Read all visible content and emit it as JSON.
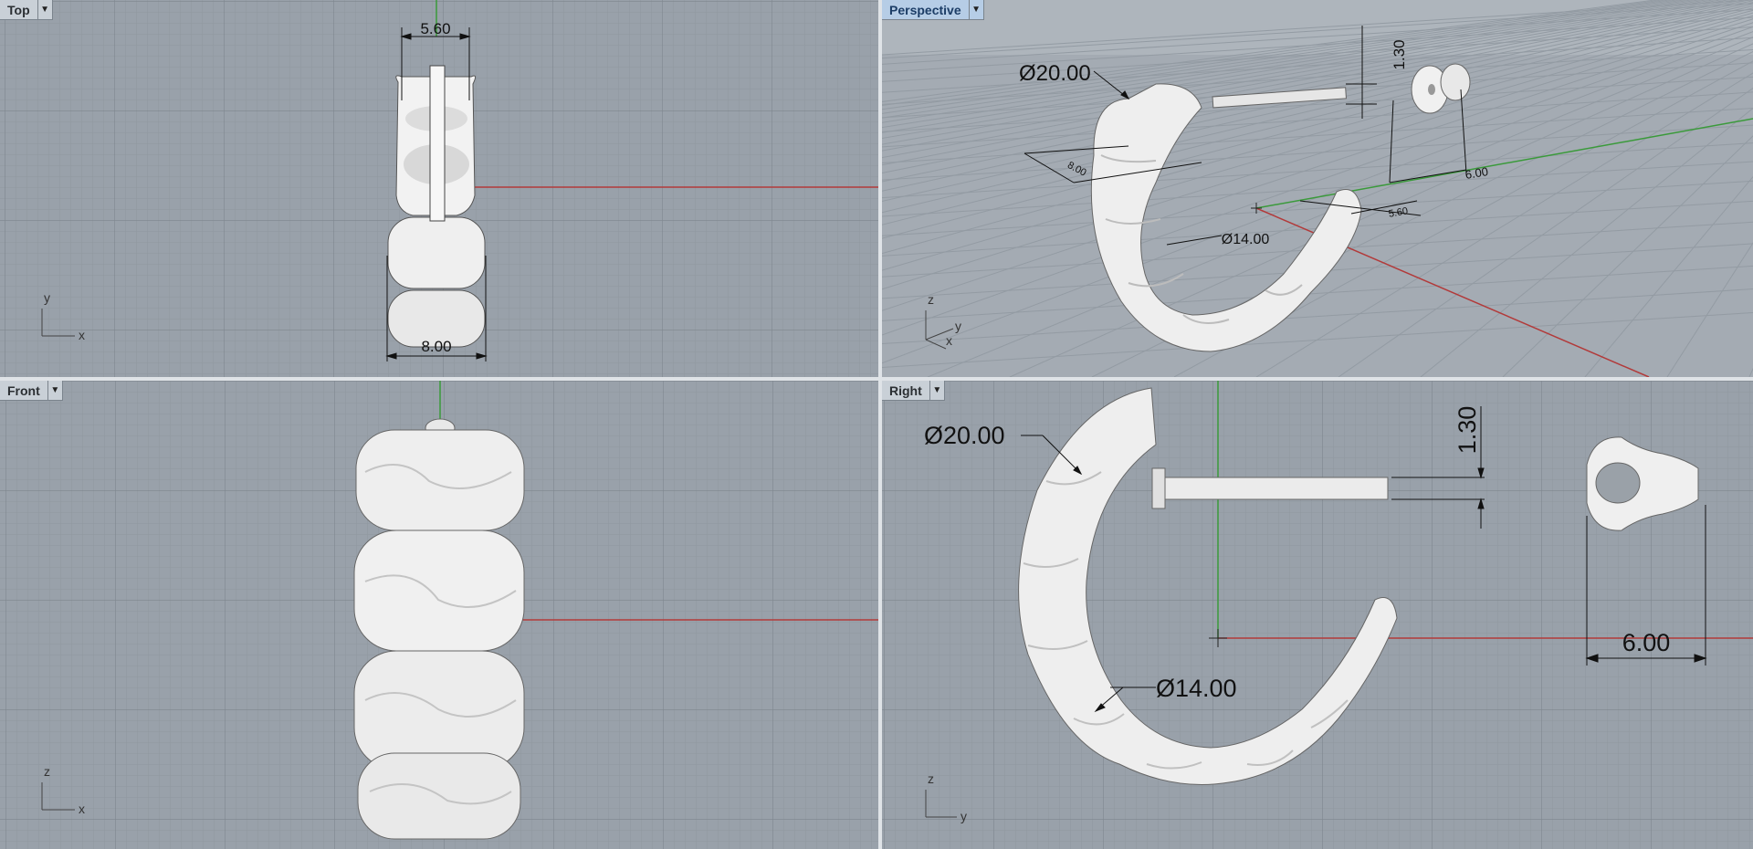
{
  "viewports": {
    "top": {
      "label": "Top",
      "dims": {
        "width_top": "5.60",
        "width_bottom": "8.00"
      },
      "axes": {
        "v": "y",
        "h": "x"
      }
    },
    "perspective": {
      "label": "Perspective",
      "dims": {
        "outer_dia": "Ø20.00",
        "inner_dia": "Ø14.00",
        "post_dia": "1.30",
        "back_width": "6.00",
        "small_a": "8.00",
        "small_b": "5.60"
      },
      "axes": {
        "v": "z",
        "h1": "x",
        "h2": "y"
      }
    },
    "front": {
      "label": "Front",
      "axes": {
        "v": "z",
        "h": "x"
      }
    },
    "right": {
      "label": "Right",
      "dims": {
        "outer_dia": "Ø20.00",
        "inner_dia": "Ø14.00",
        "post_dia": "1.30",
        "back_width": "6.00"
      },
      "axes": {
        "v": "z",
        "h": "y"
      }
    }
  },
  "colors": {
    "viewport_bg": "#99a1aa",
    "grid_minor": "#8f979f",
    "grid_major": "#7e868e",
    "x_axis": "#b23a3a",
    "y_axis": "#3a9a3a",
    "model": "#eeeeee",
    "active_tab": "#b6cde6"
  },
  "icons": {
    "caret": "dropdown-caret-icon"
  }
}
